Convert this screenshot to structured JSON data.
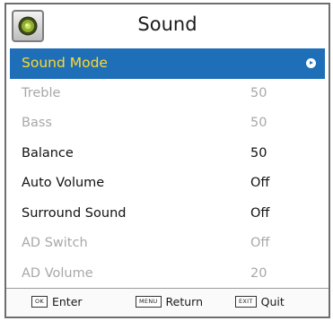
{
  "header": {
    "title": "Sound",
    "icon": "speaker-icon"
  },
  "menu": {
    "items": [
      {
        "label": "Sound Mode",
        "value": "",
        "state": "selected"
      },
      {
        "label": "Treble",
        "value": "50",
        "state": "disabled"
      },
      {
        "label": "Bass",
        "value": "50",
        "state": "disabled"
      },
      {
        "label": "Balance",
        "value": "50",
        "state": "enabled"
      },
      {
        "label": "Auto Volume",
        "value": "Off",
        "state": "enabled"
      },
      {
        "label": "Surround Sound",
        "value": "Off",
        "state": "enabled"
      },
      {
        "label": "AD Switch",
        "value": "Off",
        "state": "disabled"
      },
      {
        "label": "AD Volume",
        "value": "20",
        "state": "disabled"
      }
    ]
  },
  "footer": {
    "enter": {
      "key": "OK",
      "label": "Enter"
    },
    "return": {
      "key": "MENU",
      "label": "Return"
    },
    "quit": {
      "key": "EXIT",
      "label": "Quit"
    }
  },
  "colors": {
    "selection_background": "#1f6fb8",
    "selection_text": "#ffd92a",
    "disabled_text": "#a8a8a8"
  }
}
